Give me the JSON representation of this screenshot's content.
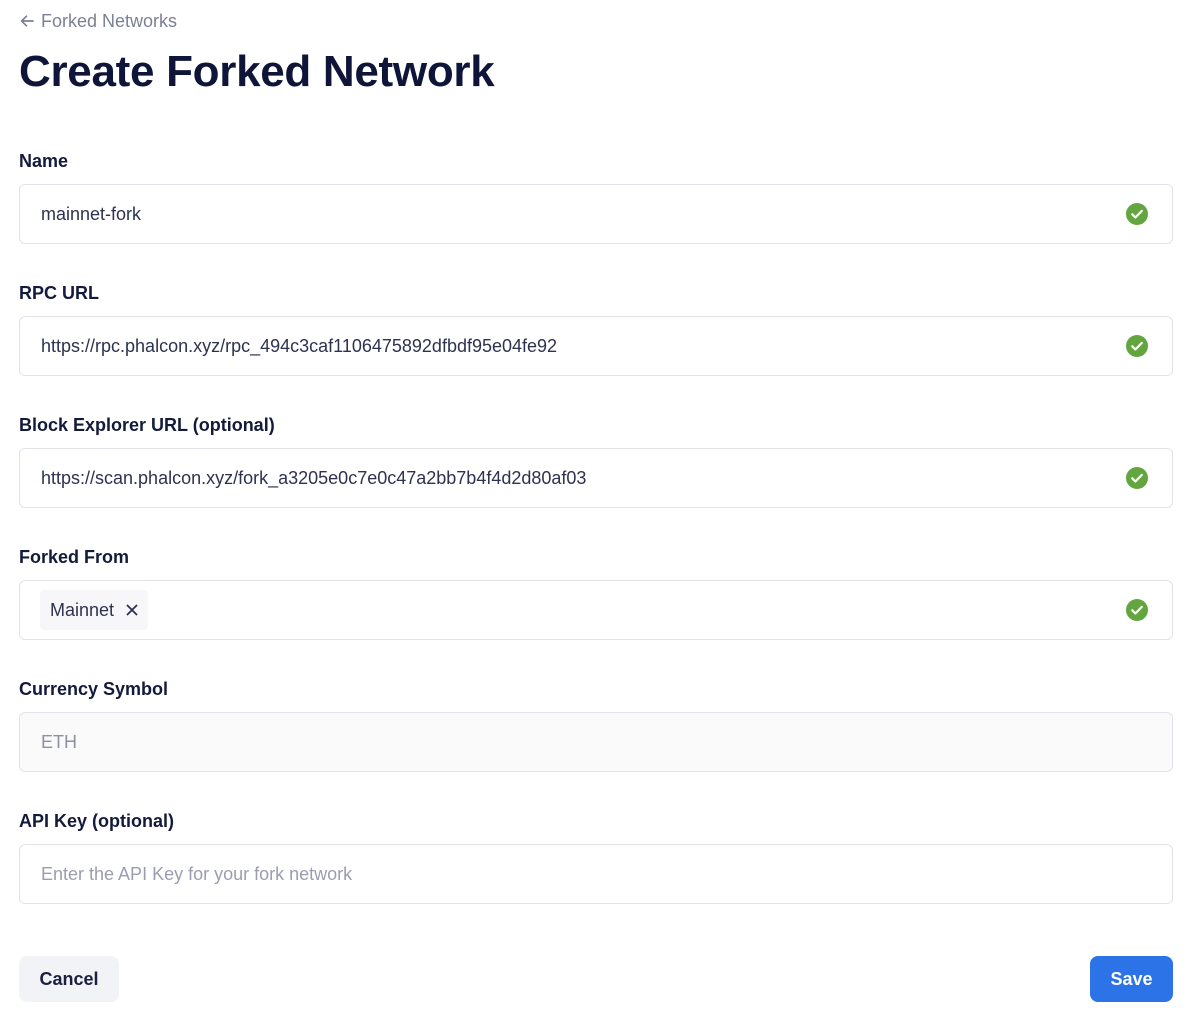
{
  "breadcrumb": {
    "back_label": "Forked Networks",
    "icon": "arrow-left-icon"
  },
  "page": {
    "title": "Create Forked Network"
  },
  "form": {
    "name": {
      "label": "Name",
      "value": "mainnet-fork",
      "valid": true
    },
    "rpc_url": {
      "label": "RPC URL",
      "value": "https://rpc.phalcon.xyz/rpc_494c3caf1106475892dfbdf95e04fe92",
      "valid": true
    },
    "block_explorer_url": {
      "label": "Block Explorer URL (optional)",
      "value": "https://scan.phalcon.xyz/fork_a3205e0c7e0c47a2bb7b4f4d2d80af03",
      "valid": true
    },
    "forked_from": {
      "label": "Forked From",
      "selected": "Mainnet",
      "remove_icon": "close-icon",
      "valid": true
    },
    "currency_symbol": {
      "label": "Currency Symbol",
      "value": "ETH",
      "disabled": true
    },
    "api_key": {
      "label": "API Key (optional)",
      "placeholder": "Enter the API Key for your fork network",
      "value": ""
    }
  },
  "actions": {
    "cancel_label": "Cancel",
    "save_label": "Save"
  },
  "colors": {
    "valid_check": "#63a53f",
    "primary_button": "#2c73e8",
    "title_text": "#0f1538",
    "muted_text": "#7c8096"
  }
}
